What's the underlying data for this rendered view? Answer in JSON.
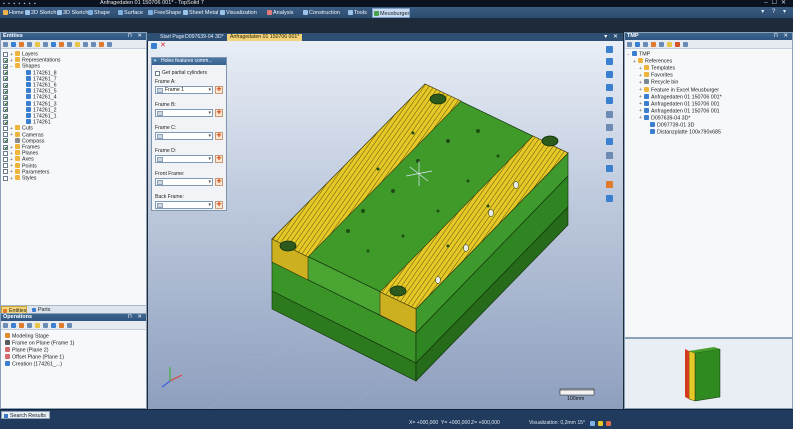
{
  "window": {
    "title": "Anfragedaten 01 150706 001* - TopSolid 7"
  },
  "menu": {
    "items": [
      {
        "label": "Home",
        "color": "#f4b24a"
      },
      {
        "label": "2D Sketch",
        "color": "#9cc3e8"
      },
      {
        "label": "3D Sketch",
        "color": "#9cc3e8"
      },
      {
        "label": "Shape",
        "color": "#7fb0e0"
      },
      {
        "label": "Surface",
        "color": "#7fb0e0"
      },
      {
        "label": "FreeShape",
        "color": "#7fb0e0"
      },
      {
        "label": "Sheet Metal",
        "color": "#9cc3e8"
      },
      {
        "label": "Visualization",
        "color": "#9cc3e8"
      },
      {
        "label": "Analysis",
        "color": "#e07b7b"
      },
      {
        "label": "Construction",
        "color": "#9cc3e8"
      },
      {
        "label": "Tools",
        "color": "#9cc3e8"
      },
      {
        "label": "Meusburger",
        "color": "#4aa34a"
      }
    ]
  },
  "entities": {
    "title": "Entities",
    "items": [
      {
        "label": "Layers",
        "icon": "folder-icon",
        "color": "#f0b43c",
        "check": "",
        "expand": "+"
      },
      {
        "label": "Representations",
        "icon": "folder-icon",
        "color": "#f0b43c",
        "check": "on",
        "expand": "+"
      },
      {
        "label": "Shapes",
        "icon": "folder-icon",
        "color": "#f0b43c",
        "check": "on",
        "expand": "−"
      },
      {
        "label": "174261_8",
        "icon": "shape-icon",
        "color": "#3a7fd0",
        "check": "on",
        "expand": ""
      },
      {
        "label": "174261_7",
        "icon": "shape-icon",
        "color": "#3a7fd0",
        "check": "on",
        "expand": ""
      },
      {
        "label": "174261_6",
        "icon": "shape-icon",
        "color": "#3a7fd0",
        "check": "on",
        "expand": ""
      },
      {
        "label": "174261_5",
        "icon": "shape-icon",
        "color": "#3a7fd0",
        "check": "on",
        "expand": ""
      },
      {
        "label": "174261_4",
        "icon": "shape-icon",
        "color": "#3a7fd0",
        "check": "on",
        "expand": ""
      },
      {
        "label": "174261_3",
        "icon": "shape-icon",
        "color": "#3a7fd0",
        "check": "on",
        "expand": ""
      },
      {
        "label": "174261_2",
        "icon": "shape-icon",
        "color": "#3a7fd0",
        "check": "on",
        "expand": ""
      },
      {
        "label": "174261_1",
        "icon": "shape-icon",
        "color": "#3a7fd0",
        "check": "on",
        "expand": ""
      },
      {
        "label": "174261",
        "icon": "shape-icon",
        "color": "#3a7fd0",
        "check": "on",
        "expand": ""
      },
      {
        "label": "Cuts",
        "icon": "folder-icon",
        "color": "#f0b43c",
        "check": "",
        "expand": "+"
      },
      {
        "label": "Cameras",
        "icon": "folder-icon",
        "color": "#f0b43c",
        "check": "",
        "expand": "+"
      },
      {
        "label": "Compass",
        "icon": "compass-icon",
        "color": "#8a8a8a",
        "check": "on",
        "expand": ""
      },
      {
        "label": "Frames",
        "icon": "folder-icon",
        "color": "#f0b43c",
        "check": "on",
        "expand": "+"
      },
      {
        "label": "Planes",
        "icon": "folder-icon",
        "color": "#f0b43c",
        "check": "",
        "expand": "+"
      },
      {
        "label": "Axes",
        "icon": "folder-icon",
        "color": "#f0b43c",
        "check": "",
        "expand": "+"
      },
      {
        "label": "Points",
        "icon": "folder-icon",
        "color": "#f0b43c",
        "check": "",
        "expand": "+"
      },
      {
        "label": "Parameters",
        "icon": "folder-icon",
        "color": "#f0b43c",
        "check": "",
        "expand": "+"
      },
      {
        "label": "Styles",
        "icon": "folder-icon",
        "color": "#f0b43c",
        "check": "",
        "expand": "+"
      }
    ],
    "tabs": [
      {
        "label": "Entities",
        "active": true
      },
      {
        "label": "Parts",
        "active": false
      }
    ]
  },
  "operations": {
    "title": "Operations",
    "items": [
      {
        "label": "Modeling Stage",
        "color": "#e28b2e"
      },
      {
        "label": "Frame on Plane (Frame 1)",
        "color": "#5a5a5a"
      },
      {
        "label": "Plane (Plane 2)",
        "color": "#d46a6a"
      },
      {
        "label": "Offset Plane (Plane 1)",
        "color": "#d46a6a"
      },
      {
        "label": "Creation (174261_...)",
        "color": "#3a7fd0"
      }
    ]
  },
  "documents": {
    "tabs": [
      {
        "label": "Start Page",
        "active": false
      },
      {
        "label": "D097639-04 3D*",
        "active": false
      },
      {
        "label": "Anfragedaten 01 150706 001*",
        "active": true
      }
    ]
  },
  "dialog": {
    "title": "Holes features comm...",
    "checkbox_label": "Get partial cylinders",
    "frames": [
      {
        "label": "Frame A:",
        "value": "Frame 1"
      },
      {
        "label": "Frame B:",
        "value": ""
      },
      {
        "label": "Frame C:",
        "value": ""
      },
      {
        "label": "Frame D:",
        "value": ""
      },
      {
        "label": "Front Frame:",
        "value": ""
      },
      {
        "label": "Back Frame:",
        "value": ""
      }
    ]
  },
  "tmp": {
    "title": "TMP",
    "items": [
      {
        "label": "TMP",
        "color": "#3a7fd0",
        "expand": "−"
      },
      {
        "label": "References",
        "color": "#f0b43c",
        "expand": "+"
      },
      {
        "label": "Templates",
        "color": "#f0b43c",
        "expand": "+"
      },
      {
        "label": "Favorites",
        "color": "#f0b43c",
        "expand": "+"
      },
      {
        "label": "Recycle bin",
        "color": "#7a8896",
        "expand": "+"
      },
      {
        "label": "Feature in Excel Meusburger",
        "color": "#f0b43c",
        "expand": "+"
      },
      {
        "label": "Anfragedaten 01 150706 001*",
        "color": "#3a7fd0",
        "expand": "+"
      },
      {
        "label": "Anfragedaten 01 150706 001",
        "color": "#3a7fd0",
        "expand": "+"
      },
      {
        "label": "Anfragedaten 01 150706 001",
        "color": "#3a7fd0",
        "expand": "+"
      },
      {
        "label": "D097639-04 3D*",
        "color": "#3a7fd0",
        "expand": "+"
      },
      {
        "label": "D097739-01 3D",
        "color": "#3a7fd0",
        "expand": ""
      },
      {
        "label": "Distanzplatte 100x790x685",
        "color": "#3a7fd0",
        "expand": ""
      }
    ]
  },
  "viewport": {
    "scale_label": "100mm"
  },
  "status": {
    "search_tab": "Search Results",
    "x": "X= +000,000",
    "y": "Y= +000,000",
    "z": "Z= +000,000",
    "visualization": "Visualization: 0,2mm 15°"
  },
  "colors": {
    "green": "#2f8a1f",
    "yellow": "#e6c826"
  }
}
